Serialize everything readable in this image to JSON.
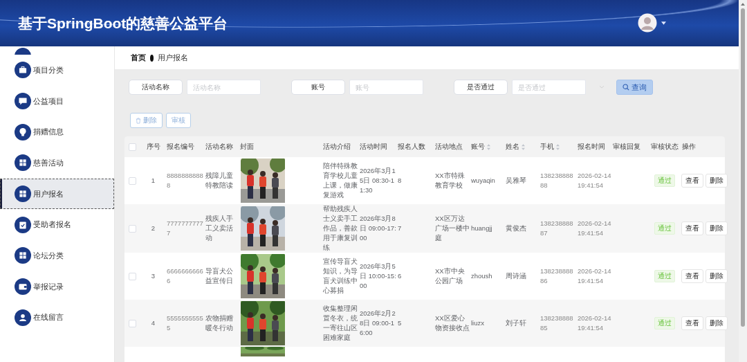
{
  "header": {
    "title": "基于SpringBoot的慈善公益平台"
  },
  "sidebar": {
    "items": [
      {
        "label": "项目分类",
        "selected": false
      },
      {
        "label": "公益项目",
        "selected": false
      },
      {
        "label": "捐赠信息",
        "selected": false
      },
      {
        "label": "慈善活动",
        "selected": false
      },
      {
        "label": "用户报名",
        "selected": true
      },
      {
        "label": "受助者报名",
        "selected": false
      },
      {
        "label": "论坛分类",
        "selected": false
      },
      {
        "label": "举报记录",
        "selected": false
      },
      {
        "label": "在线留言",
        "selected": false
      }
    ]
  },
  "breadcrumb": [
    "首页",
    "用户报名"
  ],
  "filters": [
    {
      "label": "活动名称",
      "placeholder": "活动名称",
      "kind": "text"
    },
    {
      "label": "账号",
      "placeholder": "账号",
      "kind": "text"
    },
    {
      "label": "是否通过",
      "placeholder": "是否通过",
      "kind": "select"
    }
  ],
  "search_button": "查询",
  "actions": [
    "删除",
    "审核"
  ],
  "table": {
    "header_checked": false,
    "columns": [
      {
        "label": "序号",
        "sortable": false
      },
      {
        "label": "报名编号",
        "sortable": false
      },
      {
        "label": "活动名称",
        "sortable": false
      },
      {
        "label": "封面",
        "sortable": false
      },
      {
        "label": "活动介绍",
        "sortable": false
      },
      {
        "label": "活动时间",
        "sortable": false
      },
      {
        "label": "报名人数",
        "sortable": false
      },
      {
        "label": "活动地点",
        "sortable": false
      },
      {
        "label": "账号",
        "sortable": true
      },
      {
        "label": "姓名",
        "sortable": true
      },
      {
        "label": "手机",
        "sortable": true
      },
      {
        "label": "报名时间",
        "sortable": false
      },
      {
        "label": "审核回复",
        "sortable": false
      },
      {
        "label": "审核状态",
        "sortable": false
      },
      {
        "label": "操作",
        "sortable": false
      }
    ],
    "rows": [
      {
        "checked": false,
        "index": "1",
        "code": "88888888888",
        "activity": "残障儿童特教陪读",
        "intro": "陪伴特殊教育学校儿童上课，做康复游戏",
        "time": "2026年3月15日 08:30-11:30",
        "count": "8",
        "place": "XX市特殊教育学校",
        "account": "wuyaqin",
        "name": "吴雅琴",
        "phone": "13823888888",
        "signup_time": "2026-02-14 19:41:54",
        "status": "通过",
        "buttons": [
          "查看",
          "删除"
        ]
      },
      {
        "checked": false,
        "index": "2",
        "code": "77777777777",
        "activity": "残疾人手工义卖活动",
        "intro": "帮助残疾人士义卖手工作品，善款用于康复训练",
        "time": "2026年3月8日 09:00-17:00",
        "count": "7",
        "place": "XX区万达广场一楼中庭",
        "account": "huangjj",
        "name": "黄俊杰",
        "phone": "13823888887",
        "signup_time": "2026-02-14 19:41:54",
        "status": "通过",
        "buttons": [
          "查看",
          "删除"
        ]
      },
      {
        "checked": false,
        "index": "3",
        "code": "66666666666",
        "activity": "导盲犬公益宣传日",
        "intro": "宣传导盲犬知识，为导盲犬训练中心募捐",
        "time": "2026年3月5日 10:00-15:00",
        "count": "6",
        "place": "XX市中央公园广场",
        "account": "zhoush",
        "name": "周诗涵",
        "phone": "13823888886",
        "signup_time": "2026-02-14 19:41:54",
        "status": "通过",
        "buttons": [
          "查看",
          "删除"
        ]
      },
      {
        "checked": false,
        "index": "4",
        "code": "55555555555",
        "activity": "农物捐赠暖冬行动",
        "intro": "收集整理闲置冬衣，统一寄往山区困难家庭",
        "time": "2026年2月28日 09:00-16:00",
        "count": "5",
        "place": "XX区爱心物资接收点",
        "account": "liuzx",
        "name": "刘子轩",
        "phone": "13823888885",
        "signup_time": "2026-02-14 19:41:54",
        "status": "通过",
        "buttons": [
          "查看",
          "删除"
        ]
      }
    ]
  }
}
